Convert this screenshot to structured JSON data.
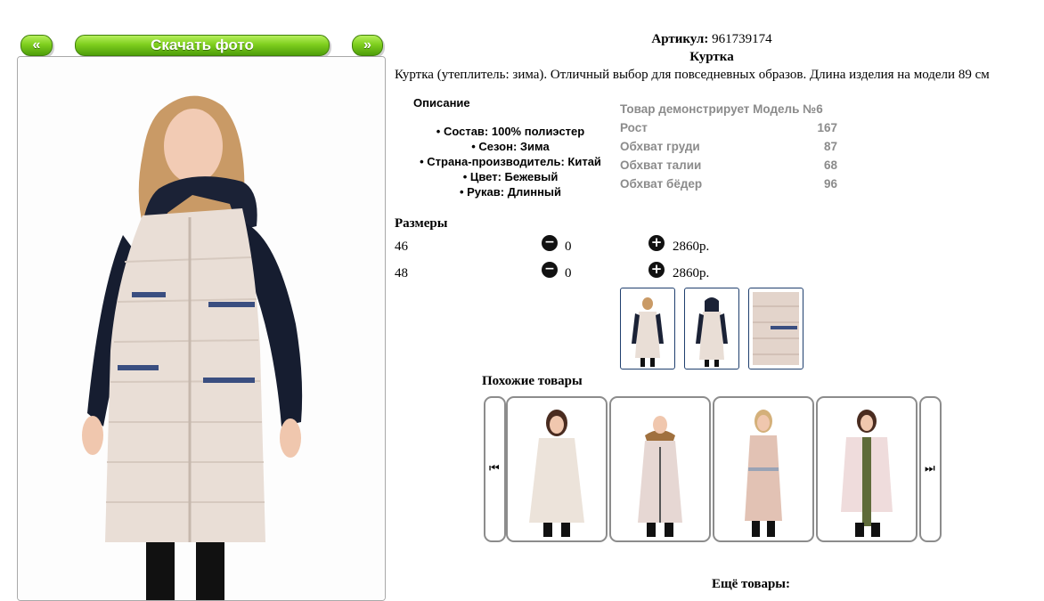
{
  "nav": {
    "prev_label": "«",
    "download_label": "Скачать фото",
    "next_label": "»"
  },
  "product": {
    "article_label": "Артикул:",
    "article_value": "961739174",
    "title": "Куртка",
    "summary": "Куртка (утеплитель: зима). Отличный выбор для повседневных образов. Длина изделия на модели 89 см"
  },
  "description": {
    "heading": "Описание",
    "items": [
      "Состав: 100% полиэстер",
      "Сезон: Зима",
      "Страна-производитель: Китай",
      "Цвет: Бежевый",
      "Рукав: Длинный"
    ]
  },
  "model": {
    "heading": "Товар демонстрирует Модель №6",
    "rows": [
      {
        "label": "Рост",
        "value": "167"
      },
      {
        "label": "Обхват груди",
        "value": "87"
      },
      {
        "label": "Обхват талии",
        "value": "68"
      },
      {
        "label": "Обхват бёдер",
        "value": "96"
      }
    ]
  },
  "sizes": {
    "heading": "Размеры",
    "rows": [
      {
        "size": "46",
        "qty": "0",
        "price": "2860р."
      },
      {
        "size": "48",
        "qty": "0",
        "price": "2860р."
      }
    ]
  },
  "similar": {
    "heading": "Похожие товары"
  },
  "more": {
    "heading": "Ещё товары:"
  },
  "colors": {
    "button_green": "#7fcf1e",
    "thumb_border": "#1f3f6e",
    "param_gray": "#8b8b8b"
  },
  "icons": {
    "minus": "minus-circle-icon",
    "plus": "plus-circle-icon",
    "carousel_prev": "skip-back-icon",
    "carousel_next": "skip-forward-icon"
  }
}
